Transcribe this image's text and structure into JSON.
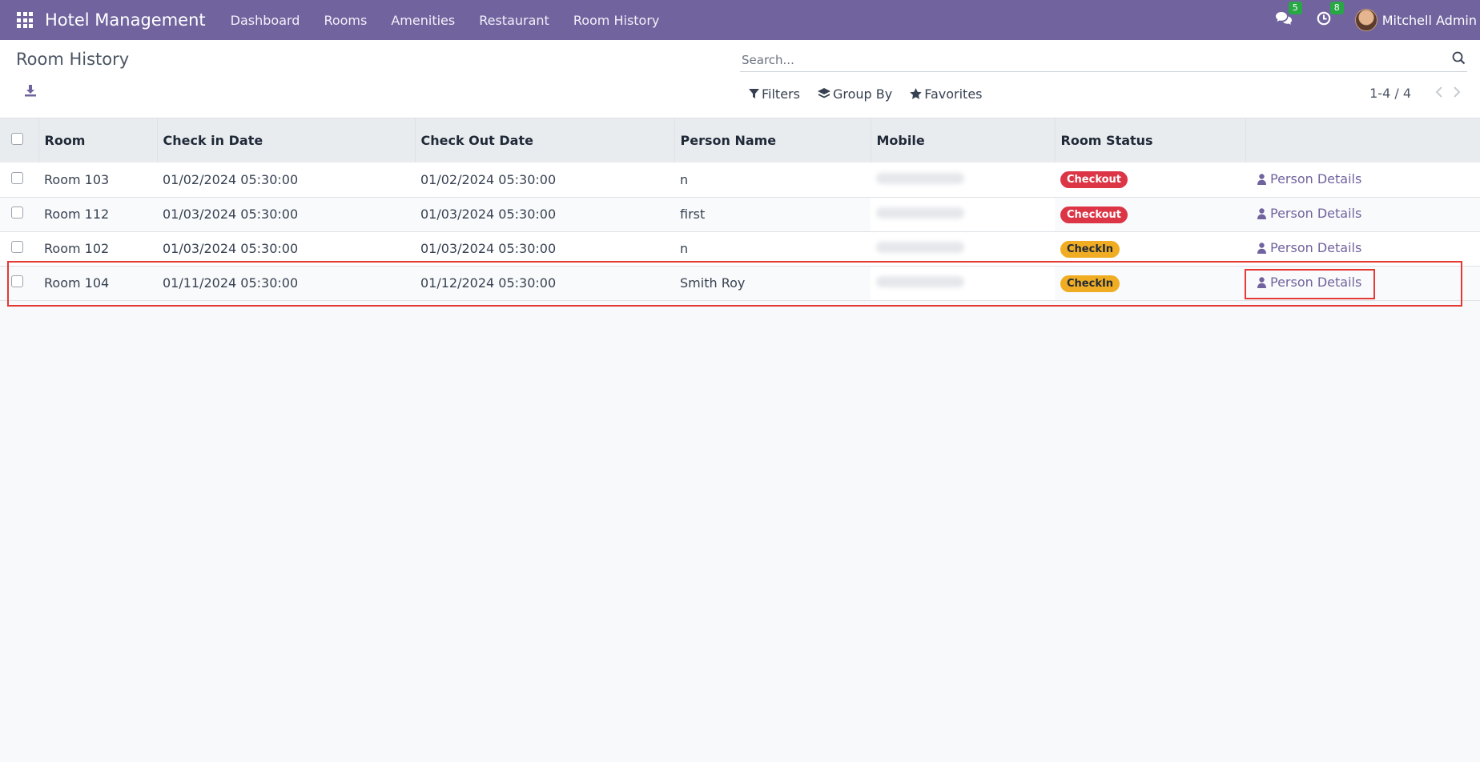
{
  "navbar": {
    "brand": "Hotel Management",
    "menu": [
      "Dashboard",
      "Rooms",
      "Amenities",
      "Restaurant",
      "Room History"
    ],
    "messages_count": "5",
    "activities_count": "8",
    "user_name": "Mitchell Admin"
  },
  "control_panel": {
    "title": "Room History",
    "search_placeholder": "Search...",
    "filters_label": "Filters",
    "group_by_label": "Group By",
    "favorites_label": "Favorites",
    "pager": "1-4 / 4"
  },
  "table": {
    "columns": [
      "Room",
      "Check in Date",
      "Check Out Date",
      "Person Name",
      "Mobile",
      "Room Status"
    ],
    "rows": [
      {
        "room": "Room 103",
        "check_in": "01/02/2024 05:30:00",
        "check_out": "01/02/2024 05:30:00",
        "person": "n",
        "status": "Checkout",
        "action": "Person Details"
      },
      {
        "room": "Room 112",
        "check_in": "01/03/2024 05:30:00",
        "check_out": "01/03/2024 05:30:00",
        "person": "first",
        "status": "Checkout",
        "action": "Person Details"
      },
      {
        "room": "Room 102",
        "check_in": "01/03/2024 05:30:00",
        "check_out": "01/03/2024 05:30:00",
        "person": "n",
        "status": "CheckIn",
        "action": "Person Details"
      },
      {
        "room": "Room 104",
        "check_in": "01/11/2024 05:30:00",
        "check_out": "01/12/2024 05:30:00",
        "person": "Smith Roy",
        "status": "CheckIn",
        "action": "Person Details"
      }
    ]
  },
  "colors": {
    "navbar": "#71639e",
    "checkout": "#dc3545",
    "checkin": "#f0ad23",
    "highlight": "#e53935"
  }
}
